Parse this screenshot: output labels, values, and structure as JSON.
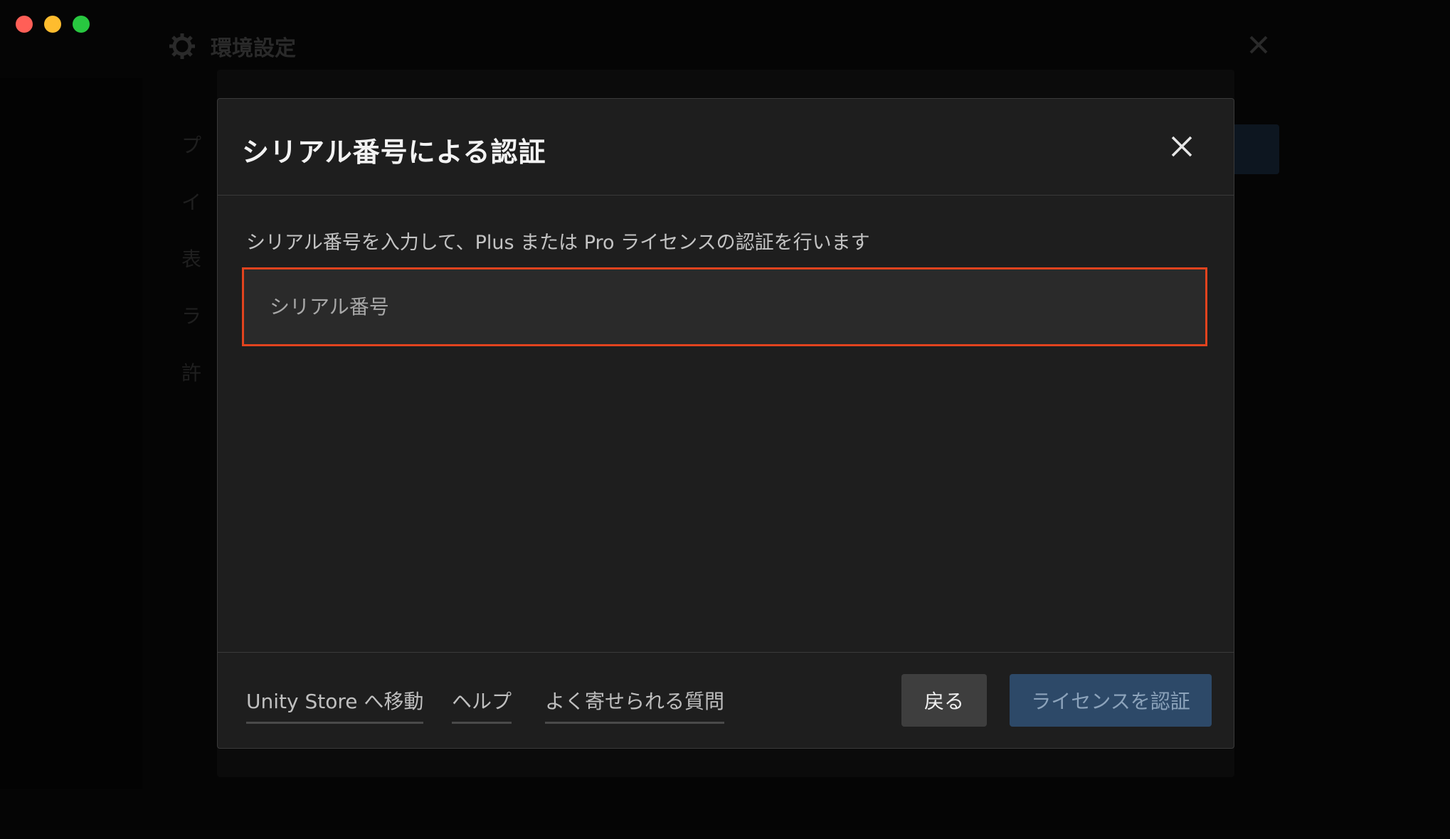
{
  "window": {
    "traffic_lights": {
      "close": "#ff5f57",
      "minimize": "#febc2e",
      "maximize": "#28c840"
    }
  },
  "background": {
    "title": "環境設定",
    "sidebar_items": [
      "プ",
      "イ",
      "表",
      "ラ",
      "許"
    ]
  },
  "dialog": {
    "title": "シリアル番号による認証",
    "description": "シリアル番号を入力して、Plus または Pro ライセンスの認証を行います",
    "serial_input": {
      "placeholder": "シリアル番号",
      "value": ""
    },
    "footer": {
      "links": {
        "store": "Unity Store へ移動",
        "help": "ヘルプ",
        "faq": "よく寄せられる質問"
      },
      "back_button": "戻る",
      "verify_button": "ライセンスを認証"
    },
    "colors": {
      "error_border": "#e2431e",
      "primary_button": "#2d4968"
    }
  }
}
